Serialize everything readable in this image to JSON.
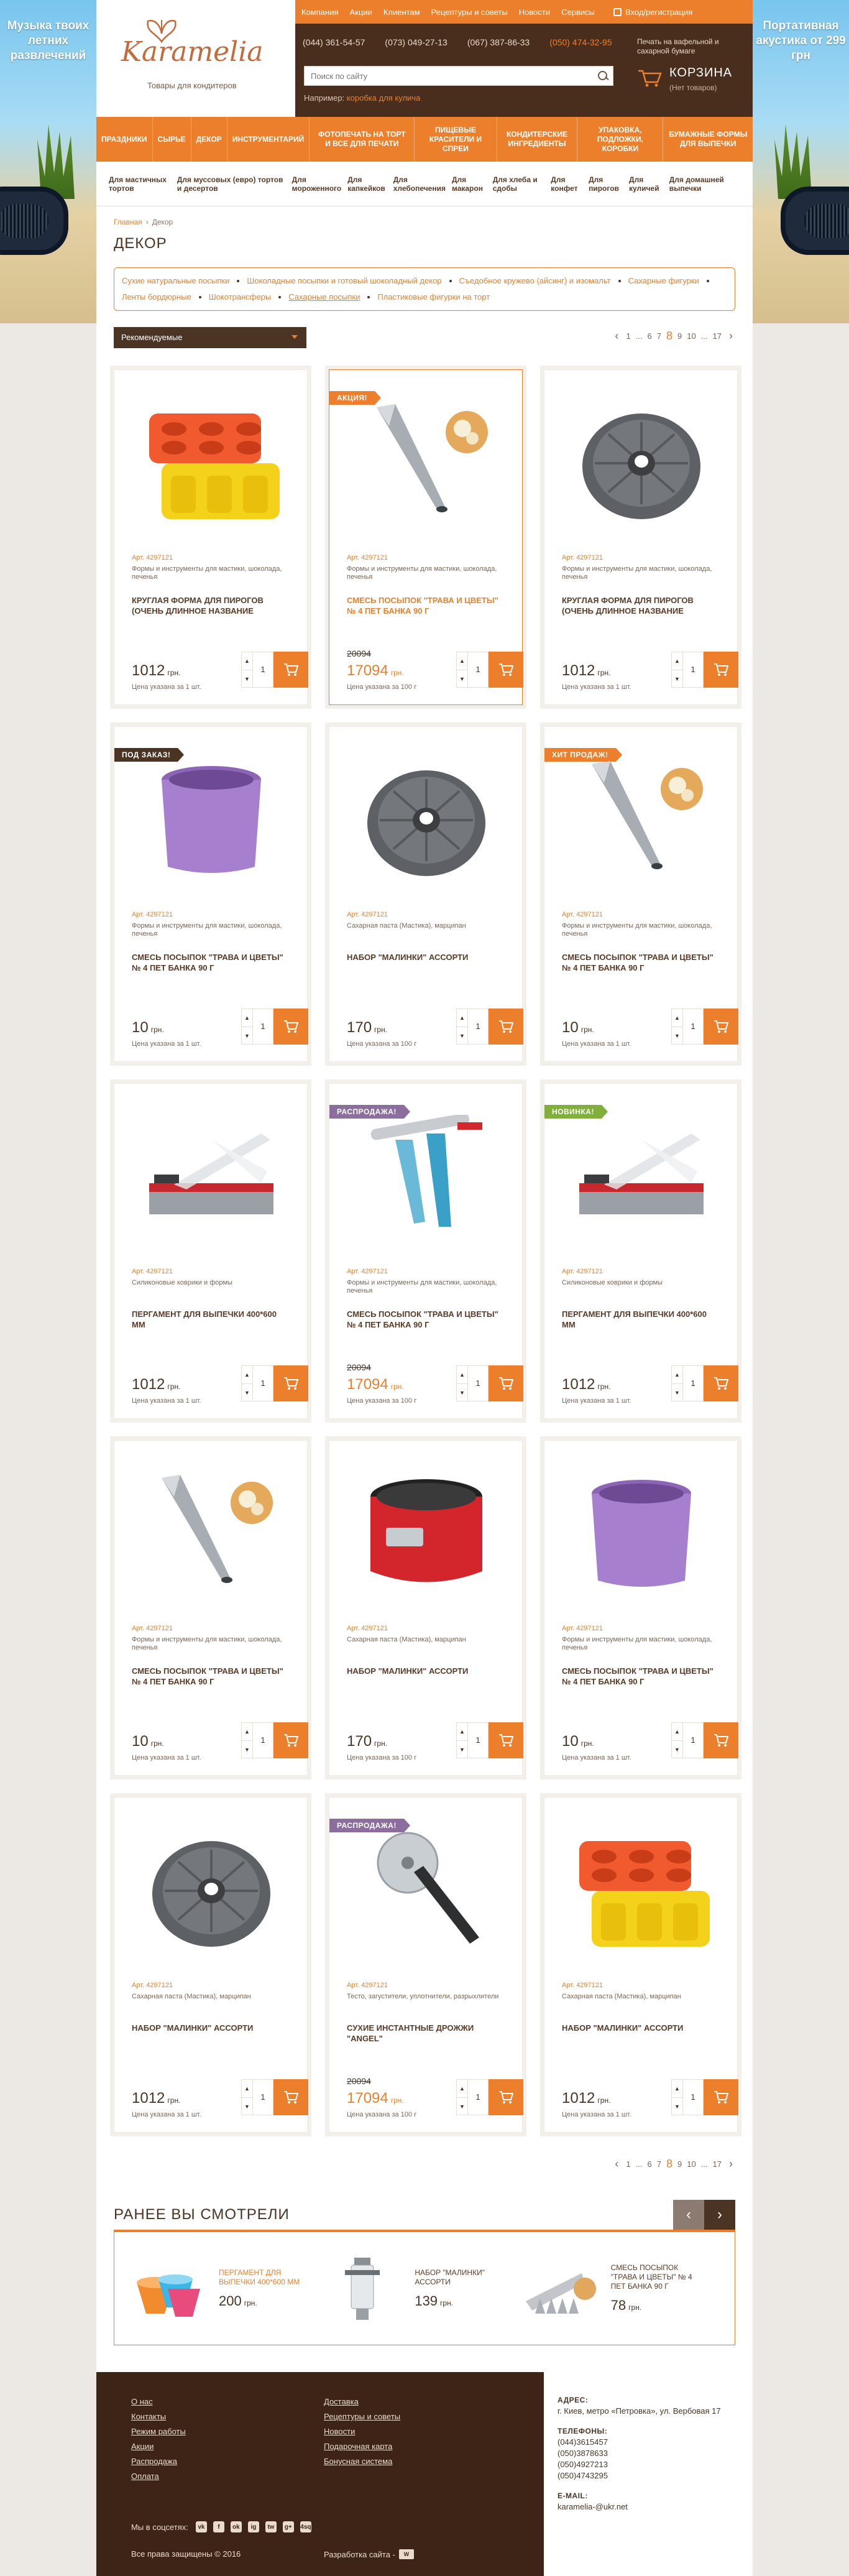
{
  "ads": {
    "left_text": "Музыка твоих летних развлечений",
    "right_text": "Портативная акустика от 299 грн"
  },
  "header": {
    "logo_word": "Karamelia",
    "logo_tagline": "Товары для кондитеров",
    "top_links": [
      "Компания",
      "Акции",
      "Клиентам",
      "Рецептуры и советы",
      "Новости",
      "Сервисы"
    ],
    "login": "Вход/регистрация",
    "phones": [
      {
        "text": "(044) 361-54-57",
        "highlight": false
      },
      {
        "text": "(073) 049-27-13",
        "highlight": false
      },
      {
        "text": "(067) 387-86-33",
        "highlight": false
      },
      {
        "text": "(050) 474-32-95",
        "highlight": true
      }
    ],
    "print_note": "Печать на вафельной и сахарной бумаге",
    "search_placeholder": "Поиск по сайту",
    "search_example_label": "Например:",
    "search_example_link": "коробка для кулича",
    "cart_title": "КОРЗИНА",
    "cart_sub": "(Нет товаров)"
  },
  "menu": {
    "main": [
      "Праздники",
      "Сырье",
      "Декор",
      "Инструментарий",
      "Фотопечать на торт и все для печати",
      "Пищевые красители и спреи",
      "Кондитерские ингредиенты",
      "Упаковка, подложки, коробки",
      "Бумажные формы для выпечки"
    ],
    "sub": [
      "Для мастичных тортов",
      "Для муссовых (евро) тортов и десертов",
      "Для мороженного",
      "Для капкейков",
      "Для хлебопечения",
      "Для макарон",
      "Для хлеба и сдобы",
      "Для конфет",
      "Для пирогов",
      "Для куличей",
      "Для домашней выпечки"
    ]
  },
  "breadcrumb": {
    "home": "Главная",
    "current": "Декор"
  },
  "page_title": "ДЕКОР",
  "tags": [
    {
      "label": "Сухие натуральные посыпки",
      "active": false
    },
    {
      "label": "Шоколадные посыпки и готовый шоколадный декор",
      "active": false
    },
    {
      "label": "Съедобное кружево (айсинг) и изомальт",
      "active": false
    },
    {
      "label": "Сахарные фигурки",
      "active": false
    },
    {
      "label": "Ленты бордюрные",
      "active": false
    },
    {
      "label": "Шокотрансферы",
      "active": false
    },
    {
      "label": "Сахарные посыпки",
      "active": true
    },
    {
      "label": "Пластиковые фигурки на торт",
      "active": false
    }
  ],
  "sort_label": "Рекомендуемые",
  "pager": [
    "1",
    "...",
    "6",
    "7",
    "8",
    "9",
    "10",
    "...",
    "17"
  ],
  "pager_current": "8",
  "pager_bottom": [
    "1",
    "...",
    "6",
    "7",
    "8",
    "9",
    "10",
    "...",
    "17"
  ],
  "products": [
    {
      "badge": "",
      "badge_color": "",
      "img": "muffin-mold",
      "art": "Арт. 4297121",
      "cat": "Формы и инструменты для мастики, шоколада, печенья",
      "name": "Круглая форма для пирогов (очень длинное название",
      "old": "",
      "price": "1012",
      "currency": "грн.",
      "note": "Цена указана за 1 шт.",
      "qty": "1",
      "selected": false,
      "name_hl": false
    },
    {
      "badge": "АКЦИЯ!",
      "badge_color": "orange",
      "img": "piping-nozzle",
      "art": "Арт. 4297121",
      "cat": "Формы и инструменты для мастики, шоколада, печенья",
      "name": "Смесь посыпок \"Трава и цветы\" № 4 ПЕТ банка 90 г",
      "old": "20094",
      "price": "17094",
      "currency": "грн.",
      "note": "Цена указана за 100 г",
      "qty": "1",
      "selected": true,
      "name_hl": true
    },
    {
      "badge": "",
      "badge_color": "",
      "img": "bundt-pan",
      "art": "Арт. 4297121",
      "cat": "Формы и инструменты для мастики, шоколада, печенья",
      "name": "Круглая форма для пирогов (очень длинное название",
      "old": "",
      "price": "1012",
      "currency": "грн.",
      "note": "Цена указана за 1 шт.",
      "qty": "1",
      "selected": false,
      "name_hl": false
    },
    {
      "badge": "ПОД ЗАКАЗ!",
      "badge_color": "brown",
      "img": "purple-mold",
      "art": "Арт. 4297121",
      "cat": "Формы и инструменты для мастики, шоколада, печенья",
      "name": "Смесь посыпок \"Трава и цветы\" № 4 ПЕТ банка 90 г",
      "old": "",
      "price": "10",
      "currency": "грн.",
      "note": "Цена указана за 1 шт.",
      "qty": "1",
      "selected": false,
      "name_hl": false
    },
    {
      "badge": "",
      "badge_color": "",
      "img": "bundt-pan",
      "art": "Арт. 4297121",
      "cat": "Сахарная паста (Мастика), марципан",
      "name": "Набор \"Малинки\" ассорти",
      "old": "",
      "price": "170",
      "currency": "грн.",
      "note": "Цена указана за 100 г",
      "qty": "1",
      "selected": false,
      "name_hl": false
    },
    {
      "badge": "ХИТ ПРОДАЖ!",
      "badge_color": "orange",
      "img": "piping-nozzle",
      "art": "Арт. 4297121",
      "cat": "Формы и инструменты для мастики, шоколада, печенья",
      "name": "Смесь посыпок \"Трава и цветы\" № 4 ПЕТ банка 90 г",
      "old": "",
      "price": "10",
      "currency": "грн.",
      "note": "Цена указана за 1 шт.",
      "qty": "1",
      "selected": false,
      "name_hl": false
    },
    {
      "badge": "",
      "badge_color": "",
      "img": "paper-cutter",
      "art": "Арт. 4297121",
      "cat": "Силиконовые коврики и формы",
      "name": "Пергамент для выпечки 400*600 мм",
      "old": "",
      "price": "1012",
      "currency": "грн.",
      "note": "Цена указана за 1 шт.",
      "qty": "1",
      "selected": false,
      "name_hl": false
    },
    {
      "badge": "РАСПРОДАЖА!",
      "badge_color": "purple",
      "img": "icing-gun",
      "art": "Арт. 4297121",
      "cat": "Формы и инструменты для мастики, шоколада, печенья",
      "name": "Смесь посыпок \"Трава и цветы\" № 4 ПЕТ банка 90 г",
      "old": "20094",
      "price": "17094",
      "currency": "грн.",
      "note": "Цена указана за 100 г",
      "qty": "1",
      "selected": false,
      "name_hl": false
    },
    {
      "badge": "НОВИНКА!",
      "badge_color": "green",
      "img": "paper-cutter",
      "art": "Арт. 4297121",
      "cat": "Силиконовые коврики и формы",
      "name": "Пергамент для выпечки 400*600 мм",
      "old": "",
      "price": "1012",
      "currency": "грн.",
      "note": "Цена указана за 1 шт.",
      "qty": "1",
      "selected": false,
      "name_hl": false
    },
    {
      "badge": "",
      "badge_color": "",
      "img": "piping-nozzle",
      "art": "Арт. 4297121",
      "cat": "Формы и инструменты для мастики, шоколада, печенья",
      "name": "Смесь посыпок \"Трава и цветы\" № 4 ПЕТ банка 90 г",
      "old": "",
      "price": "10",
      "currency": "грн.",
      "note": "Цена указана за 1 шт.",
      "qty": "1",
      "selected": false,
      "name_hl": false
    },
    {
      "badge": "",
      "badge_color": "",
      "img": "springform",
      "art": "Арт. 4297121",
      "cat": "Сахарная паста (Мастика), марципан",
      "name": "Набор \"Малинки\" ассорти",
      "old": "",
      "price": "170",
      "currency": "грн.",
      "note": "Цена указана за 100 г",
      "qty": "1",
      "selected": false,
      "name_hl": false
    },
    {
      "badge": "",
      "badge_color": "",
      "img": "purple-mold",
      "art": "Арт. 4297121",
      "cat": "Формы и инструменты для мастики, шоколада, печенья",
      "name": "Смесь посыпок \"Трава и цветы\" № 4 ПЕТ банка 90 г",
      "old": "",
      "price": "10",
      "currency": "грн.",
      "note": "Цена указана за 1 шт.",
      "qty": "1",
      "selected": false,
      "name_hl": false
    },
    {
      "badge": "",
      "badge_color": "",
      "img": "bundt-pan",
      "art": "Арт. 4297121",
      "cat": "Сахарная паста (Мастика), марципан",
      "name": "Набор \"Малинки\" ассорти",
      "old": "",
      "price": "1012",
      "currency": "грн.",
      "note": "Цена указана за 1 шт.",
      "qty": "1",
      "selected": false,
      "name_hl": false
    },
    {
      "badge": "РАСПРОДАЖА!",
      "badge_color": "purple",
      "img": "pizza-cutter",
      "art": "Арт. 4297121",
      "cat": "Тесто, загустители, уплотнители, разрыхлители",
      "name": "Сухие инстантные дрожжи \"Angel\"",
      "old": "20094",
      "price": "17094",
      "currency": "грн.",
      "note": "Цена указана за 100 г",
      "qty": "1",
      "selected": false,
      "name_hl": false
    },
    {
      "badge": "",
      "badge_color": "",
      "img": "muffin-mold",
      "art": "Арт. 4297121",
      "cat": "Сахарная паста (Мастика), марципан",
      "name": "Набор \"Малинки\" ассорти",
      "old": "",
      "price": "1012",
      "currency": "грн.",
      "note": "Цена указана за 1 шт.",
      "qty": "1",
      "selected": false,
      "name_hl": false
    }
  ],
  "recent": {
    "title": "РАНЕЕ ВЫ СМОТРЕЛИ",
    "items": [
      {
        "img": "cupcake-liners",
        "name": "Пергамент для выпечки 400*600 мм",
        "price": "200",
        "currency": "грн.",
        "hl": true
      },
      {
        "img": "cookie-press",
        "name": "Набор \"Малинки\" ассорти",
        "price": "139",
        "currency": "грн.",
        "hl": false
      },
      {
        "img": "nozzles-set",
        "name": "Смесь посыпок \"Трава и цветы\" № 4 ПЕТ банка 90 г",
        "price": "78",
        "currency": "грн.",
        "hl": false
      }
    ]
  },
  "footer": {
    "col1": [
      "О нас",
      "Контакты",
      "Режим работы",
      "Акции",
      "Распродажа",
      "Оплата"
    ],
    "col2": [
      "Доставка",
      "Рецептуры и советы",
      "Новости",
      "Подарочная карта",
      "Бонусная система"
    ],
    "social_label": "Мы в соцсетях:",
    "social_icons": [
      "vk-icon",
      "facebook-icon",
      "odnoklassniki-icon",
      "instagram-icon",
      "twitter-icon",
      "google-plus-icon",
      "foursquare-icon"
    ],
    "social_glyphs": [
      "vk",
      "f",
      "ok",
      "ig",
      "tw",
      "g+",
      "4sq"
    ],
    "copyright": "Все права защищены © 2016",
    "dev_label": "Разработка сайта -",
    "address_label": "АДРЕС:",
    "address": "г. Киев, метро «Петровка», ул. Вербовая 17",
    "phones_label": "ТЕЛЕФОНЫ:",
    "phones": [
      "(044)3615457",
      "(050)3878633",
      "(050)4927213",
      "(050)4743295"
    ],
    "email_label": "E-MAIL:",
    "email": "karamelia-@ukr.net"
  },
  "colors": {
    "accent": "#ec7f2b",
    "brown": "#4b3424",
    "dark_brown": "#3e2416",
    "purple": "#8b6e9e",
    "green": "#7fb03b"
  }
}
